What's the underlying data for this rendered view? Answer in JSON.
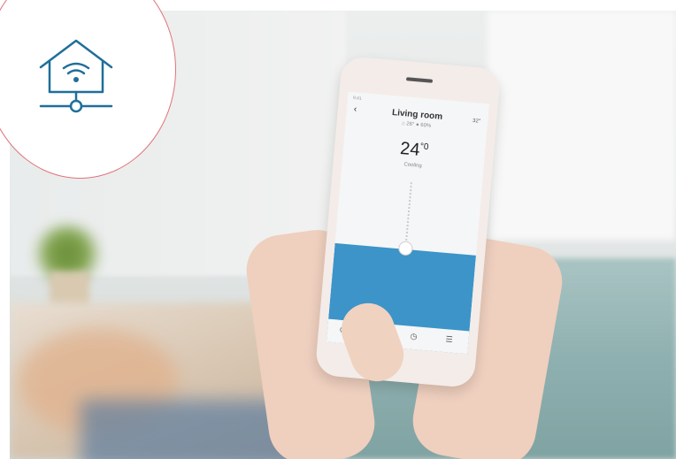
{
  "photo": {
    "badge_icon": "smart-home-wifi-icon",
    "badge_color": "#1f6f9a",
    "badge_ring_color": "#e0737b"
  },
  "app": {
    "status_left": "9:41",
    "back_icon": "chevron-left-icon",
    "room_title": "Living room",
    "outdoor_temp": "32°",
    "indoor_sensors": "⌂ 26°  ● 60%",
    "setpoint_value": "24",
    "setpoint_unit": "°",
    "setpoint_decimal": "0",
    "mode_label": "Cooling",
    "accent_color": "#3c94c9",
    "tabs": [
      "power-icon",
      "snowflake-icon",
      "timer-icon",
      "settings-icon"
    ]
  }
}
